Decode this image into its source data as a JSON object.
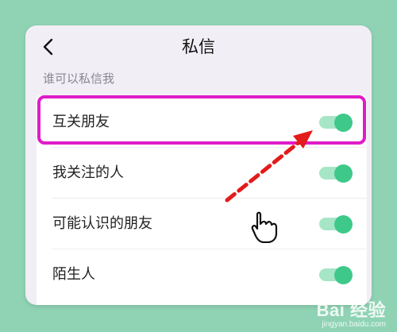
{
  "header": {
    "title": "私信",
    "back_icon": "chevron-left-icon"
  },
  "section": {
    "label": "谁可以私信我"
  },
  "rows": [
    {
      "label": "互关朋友",
      "enabled": true
    },
    {
      "label": "我关注的人",
      "enabled": true
    },
    {
      "label": "可能认识的朋友",
      "enabled": true
    },
    {
      "label": "陌生人",
      "enabled": true
    }
  ],
  "colors": {
    "background": "#8fd3b4",
    "toggle_on": "#3ec98a",
    "highlight": "#e01cc8",
    "arrow": "#e31b1b"
  },
  "watermark": {
    "brand": "Bai 经验",
    "url": "jingyan.baidu.com"
  }
}
